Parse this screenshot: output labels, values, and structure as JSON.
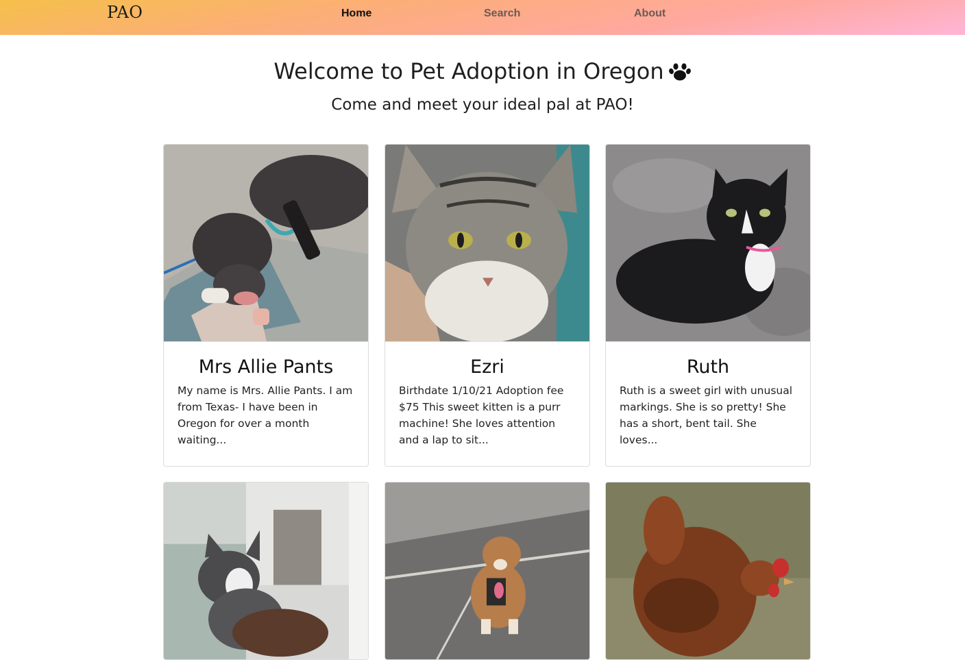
{
  "nav": {
    "brand": "PAO",
    "links": [
      "Home",
      "Search",
      "About"
    ],
    "active": "Home"
  },
  "hero": {
    "title": "Welcome to Pet Adoption in Oregon",
    "title_icon": "paw-icon",
    "subtitle": "Come and meet your ideal pal at PAO!"
  },
  "pets": [
    {
      "name": "Mrs Allie Pants",
      "description": "My name is Mrs. Allie Pants. I am from Texas- I have been in Oregon for over a month waiting...",
      "photo": "dog-photo"
    },
    {
      "name": "Ezri",
      "description": "Birthdate 1/10/21 Adoption fee $75 This sweet kitten is a purr machine! She loves attention and a lap to sit...",
      "photo": "cat-photo"
    },
    {
      "name": "Ruth",
      "description": "Ruth is a sweet girl with unusual markings. She is so pretty! She has a short, bent tail. She loves...",
      "photo": "cat-photo"
    },
    {
      "name": "",
      "description": "",
      "photo": "kitten-photo"
    },
    {
      "name": "",
      "description": "",
      "photo": "dog-photo"
    },
    {
      "name": "",
      "description": "",
      "photo": "chicken-photo"
    }
  ],
  "colors": {
    "navbar_gradient": [
      "#f5c04a",
      "#fcae78",
      "#fea8a0",
      "#ffb5d6"
    ],
    "nav_active": "#111111",
    "nav_inactive": "#6b5b55",
    "card_border": "#dcdcdc"
  }
}
